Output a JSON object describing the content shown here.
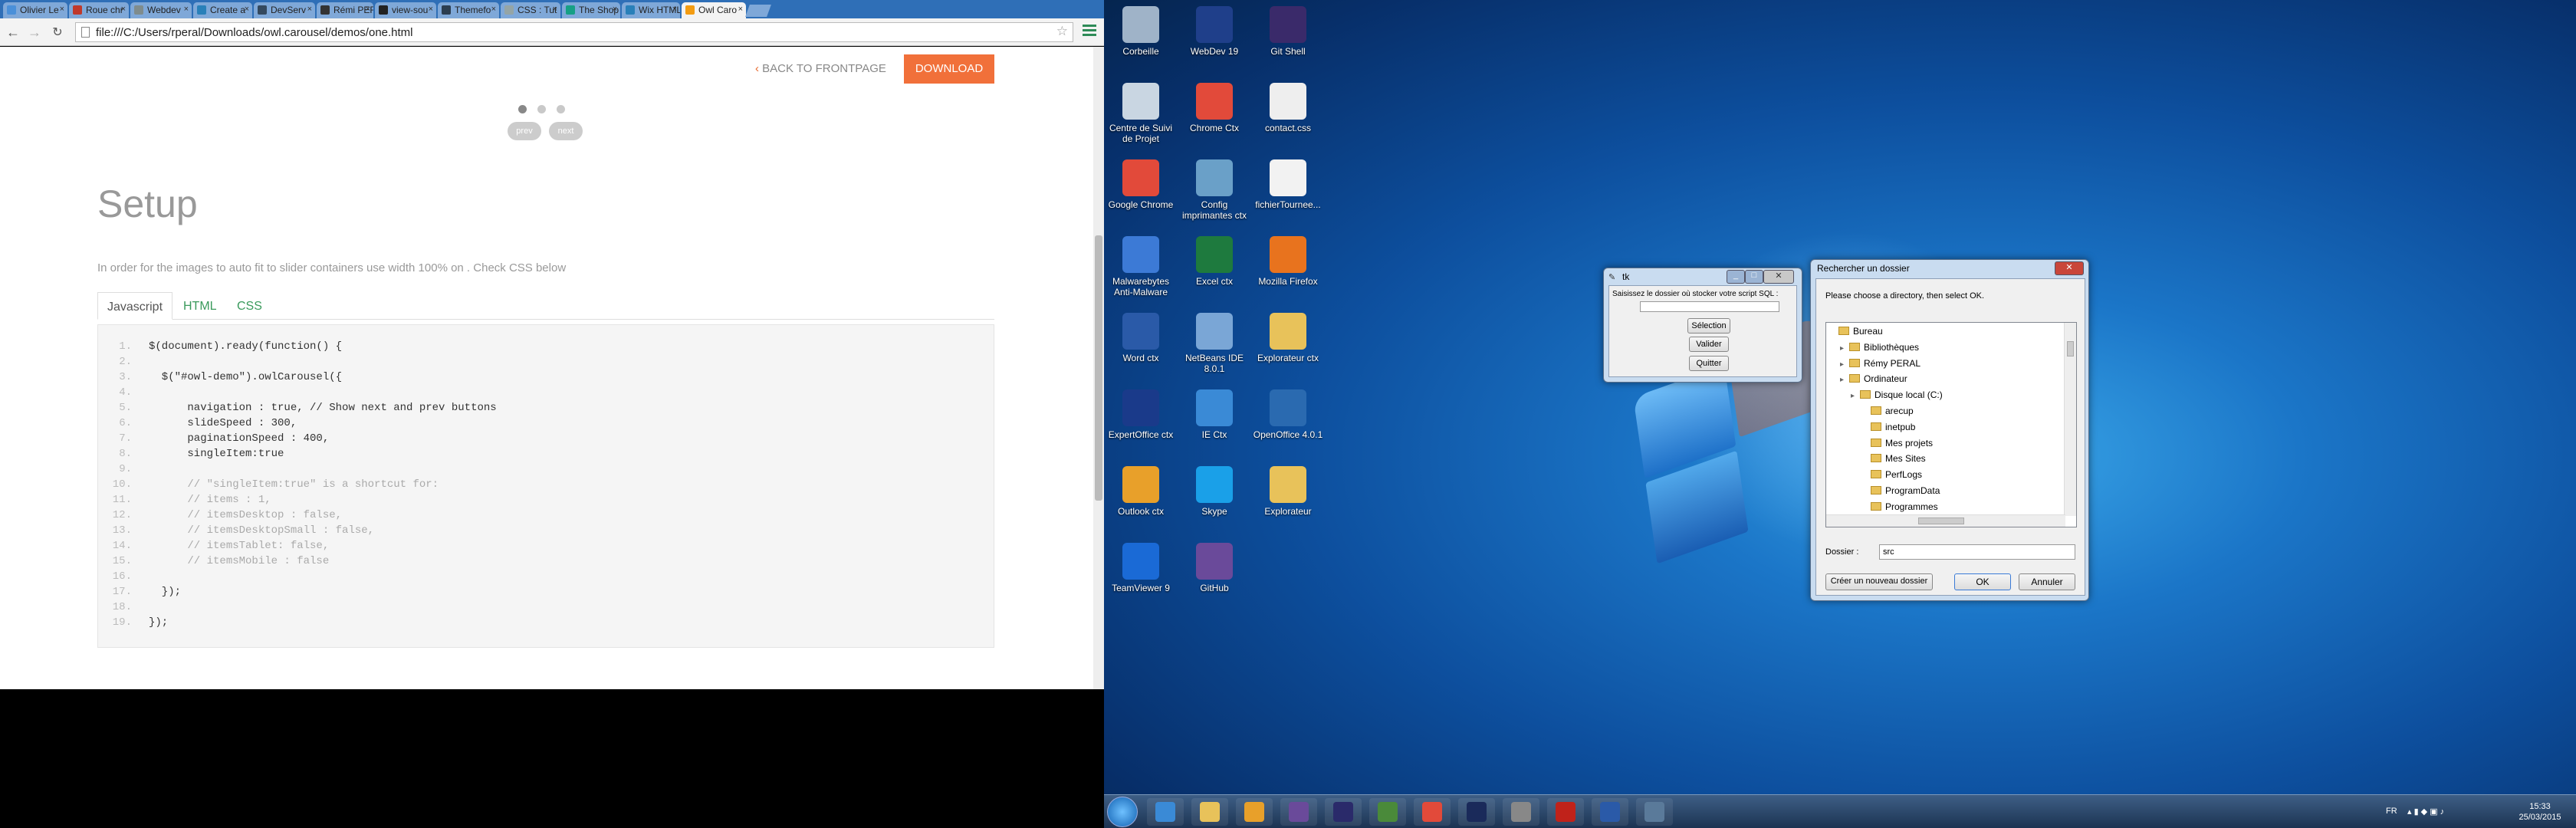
{
  "browser": {
    "tabs": [
      {
        "label": "Olivier Le",
        "color": "#4a90d9"
      },
      {
        "label": "Roue chr",
        "color": "#c0392b"
      },
      {
        "label": "Webdev",
        "color": "#7f8c8d"
      },
      {
        "label": "Create a",
        "color": "#2980b9"
      },
      {
        "label": "DevServ",
        "color": "#34495e"
      },
      {
        "label": "Rémi PER",
        "color": "#333333"
      },
      {
        "label": "view-sou",
        "color": "#222222"
      },
      {
        "label": "Themefo",
        "color": "#2c3e50"
      },
      {
        "label": "CSS : Tut",
        "color": "#95a5a6"
      },
      {
        "label": "The Shop",
        "color": "#16a085"
      },
      {
        "label": "Wix HTML",
        "color": "#2980b9"
      },
      {
        "label": "Owl Caro",
        "color": "#f39c12"
      }
    ],
    "url": "file:///C:/Users/rperal/Downloads/owl.carousel/demos/one.html"
  },
  "page": {
    "back_label": "BACK TO FRONTPAGE",
    "download_label": "DOWNLOAD",
    "prev_label": "prev",
    "next_label": "next",
    "heading": "Setup",
    "intro": "In order for the images to auto fit to slider containers use width 100% on . Check CSS below",
    "code_tabs": [
      "Javascript",
      "HTML",
      "CSS"
    ],
    "code_lines": [
      {
        "n": "1.",
        "t": "$(document).ready(function() {"
      },
      {
        "n": "2.",
        "t": ""
      },
      {
        "n": "3.",
        "t": "  $(\"#owl-demo\").owlCarousel({"
      },
      {
        "n": "4.",
        "t": ""
      },
      {
        "n": "5.",
        "t": "      navigation : true, // Show next and prev buttons"
      },
      {
        "n": "6.",
        "t": "      slideSpeed : 300,"
      },
      {
        "n": "7.",
        "t": "      paginationSpeed : 400,"
      },
      {
        "n": "8.",
        "t": "      singleItem:true"
      },
      {
        "n": "9.",
        "t": ""
      },
      {
        "n": "10.",
        "t": "      // \"singleItem:true\" is a shortcut for:"
      },
      {
        "n": "11.",
        "t": "      // items : 1,"
      },
      {
        "n": "12.",
        "t": "      // itemsDesktop : false,"
      },
      {
        "n": "13.",
        "t": "      // itemsDesktopSmall : false,"
      },
      {
        "n": "14.",
        "t": "      // itemsTablet: false,"
      },
      {
        "n": "15.",
        "t": "      // itemsMobile : false"
      },
      {
        "n": "16.",
        "t": ""
      },
      {
        "n": "17.",
        "t": "  });"
      },
      {
        "n": "18.",
        "t": ""
      },
      {
        "n": "19.",
        "t": "});"
      }
    ]
  },
  "desktop": {
    "icons": [
      {
        "label": "Corbeille",
        "color": "#9fb3c8"
      },
      {
        "label": "WebDev 19",
        "color": "#1f3f8a"
      },
      {
        "label": "Git Shell",
        "color": "#3a2a6a"
      },
      {
        "label": "Centre de Suivi de Projet",
        "color": "#c9d6e2"
      },
      {
        "label": "Chrome Ctx",
        "color": "#e24a3a"
      },
      {
        "label": "contact.css",
        "color": "#eeeeee"
      },
      {
        "label": "Google Chrome",
        "color": "#e24a3a"
      },
      {
        "label": "Config imprimantes ctx",
        "color": "#6aa0c8"
      },
      {
        "label": "fichierTournee...",
        "color": "#f2f2f2"
      },
      {
        "label": "Malwarebytes Anti-Malware",
        "color": "#3c7ad6"
      },
      {
        "label": "Excel ctx",
        "color": "#1e7a3e"
      },
      {
        "label": "Mozilla Firefox",
        "color": "#e8731e"
      },
      {
        "label": "Word ctx",
        "color": "#2a5aa8"
      },
      {
        "label": "NetBeans IDE 8.0.1",
        "color": "#7aa6d6"
      },
      {
        "label": "Explorateur ctx",
        "color": "#e8c25a"
      },
      {
        "label": "ExpertOffice ctx",
        "color": "#1a3a8a"
      },
      {
        "label": "IE Ctx",
        "color": "#3a8ad6"
      },
      {
        "label": "OpenOffice 4.0.1",
        "color": "#2a6ab0"
      },
      {
        "label": "Outlook ctx",
        "color": "#e8a02a"
      },
      {
        "label": "Skype",
        "color": "#1aa0e8"
      },
      {
        "label": "Explorateur",
        "color": "#e8c25a"
      },
      {
        "label": "TeamViewer 9",
        "color": "#1a6ad6"
      },
      {
        "label": "GitHub",
        "color": "#6a4a9a"
      }
    ],
    "tk": {
      "title": "tk",
      "prompt": "Saisissez le dossier où stocker votre script SQL :",
      "input": "",
      "btn_selection": "Sélection",
      "btn_valider": "Valider",
      "btn_quitter": "Quitter"
    },
    "browse": {
      "title": "Rechercher un dossier",
      "instruction": "Please choose a directory, then select OK.",
      "tree": [
        {
          "label": "Bureau",
          "level": 0
        },
        {
          "label": "Bibliothèques",
          "level": 1
        },
        {
          "label": "Rémy PERAL",
          "level": 1
        },
        {
          "label": "Ordinateur",
          "level": 1
        },
        {
          "label": "Disque local (C:)",
          "level": 2
        },
        {
          "label": "arecup",
          "level": 3
        },
        {
          "label": "inetpub",
          "level": 3
        },
        {
          "label": "Mes projets",
          "level": 3
        },
        {
          "label": "Mes Sites",
          "level": 3
        },
        {
          "label": "PerfLogs",
          "level": 3
        },
        {
          "label": "ProgramData",
          "level": 3
        },
        {
          "label": "Programmes",
          "level": 3
        }
      ],
      "folder_label": "Dossier :",
      "folder_value": "src",
      "new_folder": "Créer un nouveau dossier",
      "ok": "OK",
      "cancel": "Annuler"
    },
    "taskbar": {
      "apps": [
        {
          "name": "ie",
          "color": "#3a8ad6"
        },
        {
          "name": "explorer",
          "color": "#e8c25a"
        },
        {
          "name": "media",
          "color": "#e8a02a"
        },
        {
          "name": "app",
          "color": "#6a4a9a"
        },
        {
          "name": "app2",
          "color": "#2a2a6a"
        },
        {
          "name": "app3",
          "color": "#4a8a3a"
        },
        {
          "name": "chrome",
          "color": "#e24a3a"
        },
        {
          "name": "photoshop",
          "color": "#1a2a5a"
        },
        {
          "name": "app4",
          "color": "#888888"
        },
        {
          "name": "acrobat",
          "color": "#c0221a"
        },
        {
          "name": "word",
          "color": "#2a5aa8"
        },
        {
          "name": "app5",
          "color": "#5a7a9a"
        }
      ],
      "lang": "FR",
      "time": "15:33",
      "date": "25/03/2015"
    }
  }
}
